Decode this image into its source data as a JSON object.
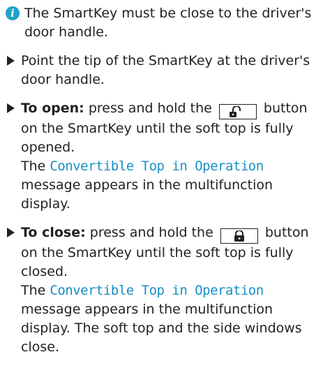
{
  "note": {
    "icon": "info-icon",
    "icon_glyph": "i",
    "icon_color": "#20a0c8",
    "text": "The SmartKey must be close to the driver's door handle."
  },
  "steps": [
    {
      "text": "Point the tip of the SmartKey at the driver's door handle."
    },
    {
      "label": "To open:",
      "text_before_key": "press and hold the",
      "key_icon": "unlock-icon",
      "text_after_key": "button on the SmartKey until the soft top is fully opened.",
      "result_prefix": "The",
      "message": "Convertible Top in Operation",
      "result_suffix": "message appears in the multifunction display."
    },
    {
      "label": "To close:",
      "text_before_key": "press and hold the",
      "key_icon": "lock-icon",
      "text_after_key": "button on the SmartKey until the soft top is fully closed.",
      "result_prefix": "The",
      "message": "Convertible Top in Operation",
      "result_suffix": "message appears in the multifunction display. The soft top and the side windows close."
    }
  ],
  "colors": {
    "text": "#222222",
    "message": "#1a8fc4"
  }
}
